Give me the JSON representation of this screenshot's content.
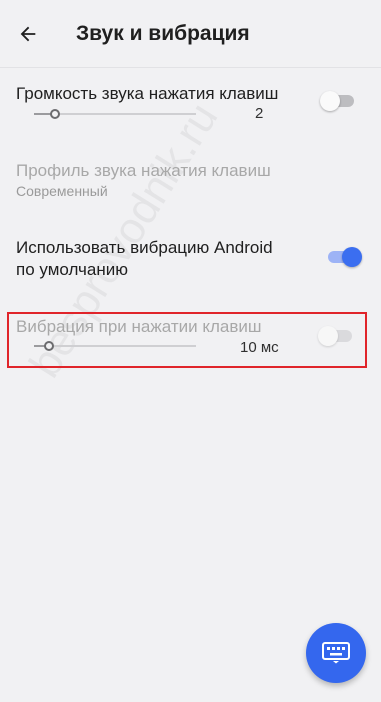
{
  "appbar": {
    "title": "Звук и вибрация",
    "back_icon": "arrow-back-icon"
  },
  "settings": [
    {
      "title": "Громкость звука нажатия клавиш",
      "slider_value": "2",
      "slider_fraction": 0.13,
      "toggle": "off"
    },
    {
      "title": "Профиль звука нажатия клавиш",
      "subtitle": "Современный",
      "enabled": false
    },
    {
      "title_line1": "Использовать вибрацию Android",
      "title_line2": "по умолчанию",
      "toggle": "on"
    },
    {
      "title": "Вибрация при нажатии клавиш",
      "slider_value": "10 мс",
      "slider_fraction": 0.08,
      "toggle": "off",
      "enabled": false
    }
  ],
  "watermark": "besprovodnik.ru",
  "fab": {
    "icon": "keyboard-icon"
  },
  "colors": {
    "accent": "#3467ee",
    "highlight": "#e0242a",
    "background": "#f1f1f3"
  }
}
